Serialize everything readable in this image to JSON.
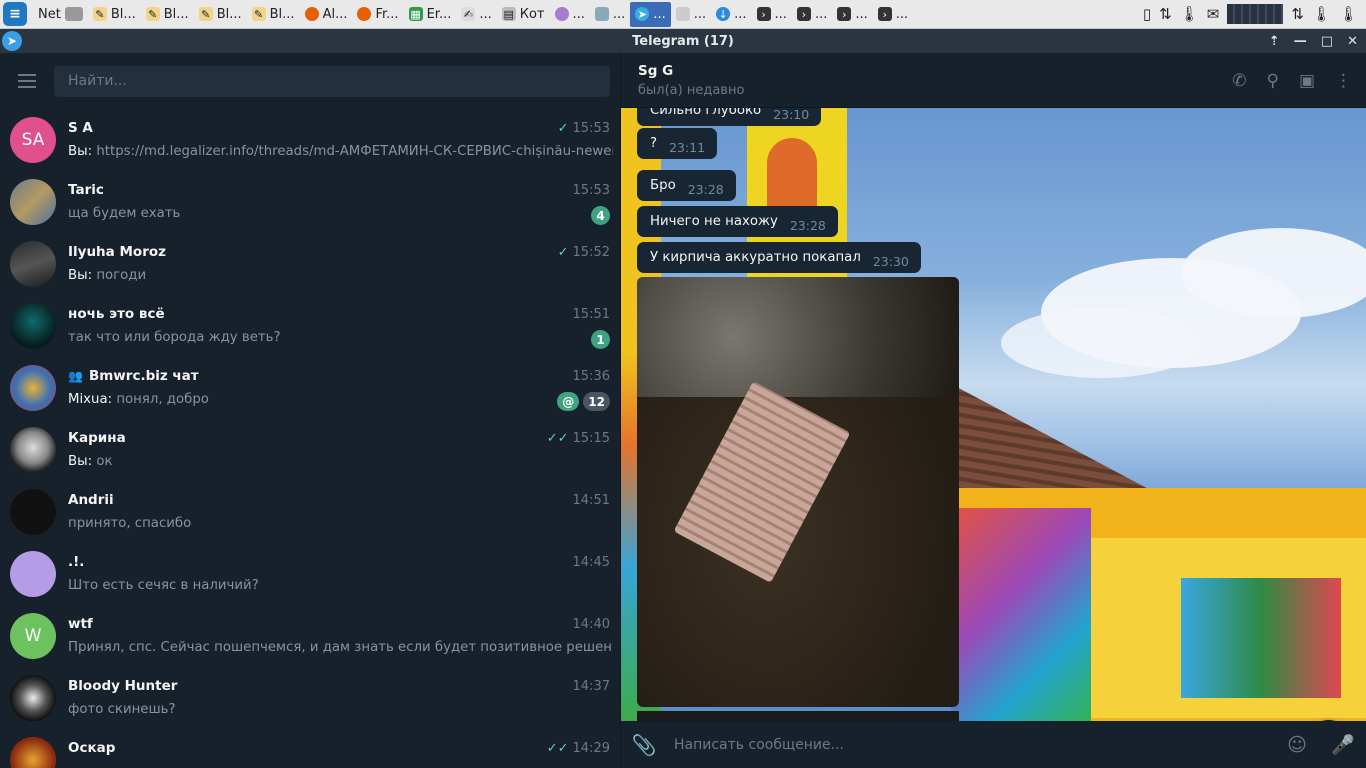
{
  "taskbar": {
    "items": [
      {
        "label": "Net",
        "icon": "network-icon"
      },
      {
        "label": "Bl...",
        "icon": "document-icon"
      },
      {
        "label": "Bl...",
        "icon": "document-icon"
      },
      {
        "label": "Bl...",
        "icon": "document-icon"
      },
      {
        "label": "Bl...",
        "icon": "document-icon"
      },
      {
        "label": "Al...",
        "icon": "firefox-icon"
      },
      {
        "label": "Fr...",
        "icon": "firefox-icon"
      },
      {
        "label": "Er...",
        "icon": "spreadsheet-icon"
      },
      {
        "label": "...",
        "icon": "editor-icon"
      },
      {
        "label": "Кот",
        "icon": "files-icon"
      },
      {
        "label": "...",
        "icon": "app-icon"
      },
      {
        "label": "...",
        "icon": "app-icon"
      },
      {
        "label": "...",
        "icon": "telegram-icon"
      },
      {
        "label": "...",
        "icon": "app-icon"
      },
      {
        "label": "...",
        "icon": "download-icon"
      },
      {
        "label": "...",
        "icon": "terminal-icon"
      },
      {
        "label": "...",
        "icon": "terminal-icon"
      },
      {
        "label": "...",
        "icon": "terminal-icon"
      },
      {
        "label": "...",
        "icon": "terminal-icon"
      }
    ]
  },
  "window": {
    "title": "Telegram (17)"
  },
  "sidebar": {
    "search_placeholder": "Найти...",
    "chats": [
      {
        "name": "S A",
        "time": "15:53",
        "read": "single",
        "preview_prefix": "Вы:",
        "preview": " https://md.legalizer.info/threads/md-АМФЕТАМИН-СК-СЕРВИС-chișinău-newerasto...",
        "avatar_text": "SA",
        "avatar_color": "#e0508d"
      },
      {
        "name": "Taric",
        "time": "15:53",
        "preview": "ща будем ехать",
        "badge": "4"
      },
      {
        "name": "Ilyuha Moroz",
        "time": "15:52",
        "read": "single",
        "preview_prefix": "Вы:",
        "preview": " погоди"
      },
      {
        "name": "ночь это всё",
        "time": "15:51",
        "preview": "так что или борода жду веть?",
        "badge": "1"
      },
      {
        "name": "Bmwrc.biz чат",
        "group": true,
        "time": "15:36",
        "preview_prefix": "Mixua:",
        "preview": " понял, добро",
        "mention": "@",
        "badge": "12"
      },
      {
        "name": "Карина",
        "time": "15:15",
        "read": "double",
        "preview_prefix": "Вы:",
        "preview": " ок"
      },
      {
        "name": "Andrii",
        "time": "14:51",
        "preview": "принято, спасибо"
      },
      {
        "name": ".!.",
        "time": "14:45",
        "preview": "Што есть сечяс в наличий?",
        "avatar_color": "#b59ce6"
      },
      {
        "name": "wtf",
        "time": "14:40",
        "preview": "Принял, спс. Сейчас пошепчемся, и дам знать если будет позитивное решение",
        "avatar_text": "W",
        "avatar_color": "#6cc25e"
      },
      {
        "name": "Bloody Hunter",
        "time": "14:37",
        "preview": "фото скинешь?"
      },
      {
        "name": "Оскар",
        "time": "14:29",
        "read": "double",
        "preview": ""
      }
    ]
  },
  "conversation": {
    "peer_name": "Sg G",
    "peer_status": "был(а) недавно",
    "messages": [
      {
        "text": "Сильно глубоко",
        "time": "23:10"
      },
      {
        "text": "?",
        "time": "23:11"
      },
      {
        "text": "Бро",
        "time": "23:28"
      },
      {
        "text": "Ничего не нахожу",
        "time": "23:28"
      },
      {
        "text": "У кирпича  аккуратно покапал",
        "time": "23:30"
      }
    ],
    "compose_placeholder": "Написать сообщение..."
  },
  "colors": {
    "accent": "#5fd0c2",
    "badge": "#3fa37f",
    "bg": "#17212b"
  }
}
